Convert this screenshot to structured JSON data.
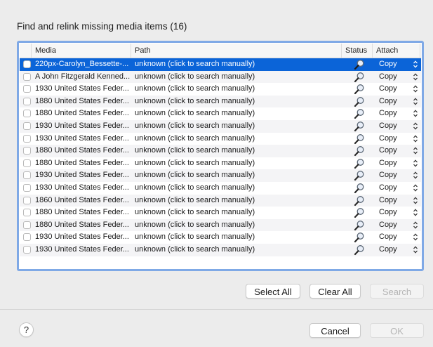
{
  "dialog": {
    "title": "Find and relink missing media items (16)"
  },
  "table": {
    "columns": [
      "Media",
      "Path",
      "Status",
      "Attach"
    ],
    "rows": [
      {
        "media": "220px-Carolyn_Bessette-...",
        "path": "unknown (click to search manually)",
        "attach": "Copy",
        "selected": true
      },
      {
        "media": "A John Fitzgerald Kenned...",
        "path": "unknown (click to search manually)",
        "attach": "Copy"
      },
      {
        "media": "1930 United States Feder...",
        "path": "unknown (click to search manually)",
        "attach": "Copy"
      },
      {
        "media": "1880 United States Feder...",
        "path": "unknown (click to search manually)",
        "attach": "Copy"
      },
      {
        "media": "1880 United States Feder...",
        "path": "unknown (click to search manually)",
        "attach": "Copy"
      },
      {
        "media": "1930 United States Feder...",
        "path": "unknown (click to search manually)",
        "attach": "Copy"
      },
      {
        "media": "1930 United States Feder...",
        "path": "unknown (click to search manually)",
        "attach": "Copy"
      },
      {
        "media": "1880 United States Feder...",
        "path": "unknown (click to search manually)",
        "attach": "Copy"
      },
      {
        "media": "1880 United States Feder...",
        "path": "unknown (click to search manually)",
        "attach": "Copy"
      },
      {
        "media": "1930 United States Feder...",
        "path": "unknown (click to search manually)",
        "attach": "Copy"
      },
      {
        "media": "1930 United States Feder...",
        "path": "unknown (click to search manually)",
        "attach": "Copy"
      },
      {
        "media": "1860 United States Feder...",
        "path": "unknown (click to search manually)",
        "attach": "Copy"
      },
      {
        "media": "1880 United States Feder...",
        "path": "unknown (click to search manually)",
        "attach": "Copy"
      },
      {
        "media": "1880 United States Feder...",
        "path": "unknown (click to search manually)",
        "attach": "Copy"
      },
      {
        "media": "1930 United States Feder...",
        "path": "unknown (click to search manually)",
        "attach": "Copy"
      },
      {
        "media": "1930 United States Feder...",
        "path": "unknown (click to search manually)",
        "attach": "Copy"
      }
    ],
    "status_icon": "magnifier-icon",
    "accent_color": "#0b64d8",
    "focus_ring_color": "#7fa9e6"
  },
  "buttons": {
    "select_all": "Select All",
    "clear_all": "Clear All",
    "search": "Search",
    "cancel": "Cancel",
    "ok": "OK",
    "help": "?"
  }
}
